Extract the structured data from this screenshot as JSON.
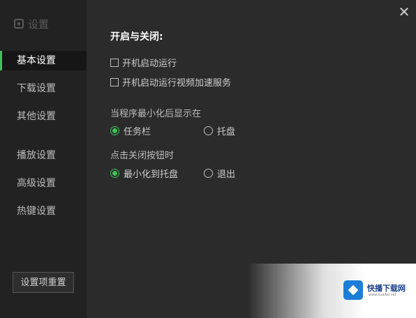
{
  "window": {
    "title": "设置",
    "close_glyph": "✕"
  },
  "sidebar": {
    "items": [
      {
        "label": "基本设置",
        "active": true
      },
      {
        "label": "下载设置"
      },
      {
        "label": "其他设置"
      },
      {
        "label": "播放设置"
      },
      {
        "label": "高级设置"
      },
      {
        "label": "热键设置"
      }
    ],
    "reset_label": "设置项重置"
  },
  "main": {
    "section_title": "开启与关闭:",
    "checkbox_autostart": "开机启动运行",
    "checkbox_video_accel": "开机启动运行视频加速服务",
    "minimize_label": "当程序最小化后显示在",
    "minimize_options": [
      "任务栏",
      "托盘"
    ],
    "close_label": "点击关闭按钮时",
    "close_options": [
      "最小化到托盘",
      "退出"
    ]
  },
  "watermark": {
    "text": "快播下载网",
    "sub": "www.kuaibo.net"
  },
  "colors": {
    "accent": "#3ec35a",
    "background": "#2b2b2b",
    "sidebar": "#222222"
  }
}
